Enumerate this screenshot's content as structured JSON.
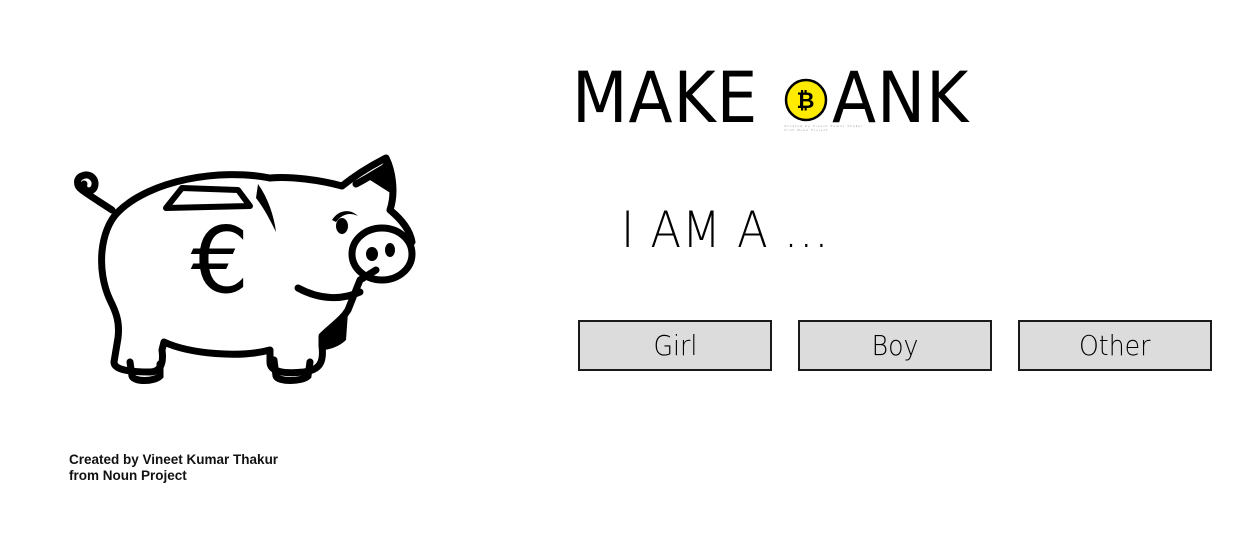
{
  "logo": {
    "text_before": "MAKE",
    "text_after": "ANK",
    "coin_icon": "bitcoin-coin-icon",
    "coin_color": "#FFEB00",
    "coin_caption_line1": "Created by Vineet Kumar Thakur",
    "coin_caption_line2": "from Noun Project"
  },
  "illustration": {
    "icon": "piggy-bank-euro-icon",
    "credit_line1": "Created by Vineet Kumar Thakur",
    "credit_line2": "from Noun Project"
  },
  "question": {
    "text": "I AM A ..."
  },
  "choices": [
    {
      "label": "Girl"
    },
    {
      "label": "Boy"
    },
    {
      "label": "Other"
    }
  ],
  "colors": {
    "button_bg": "#DCDCDC",
    "button_border": "#1A1A1A",
    "text": "#000000",
    "background": "#FFFFFF"
  }
}
